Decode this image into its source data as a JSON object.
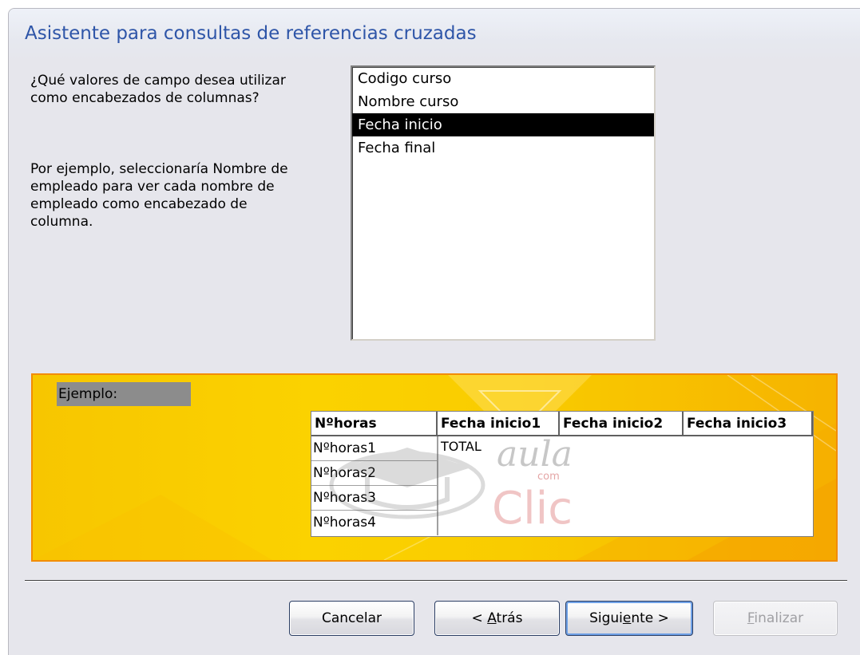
{
  "dialog": {
    "title": "Asistente para consultas de referencias cruzadas"
  },
  "prompts": {
    "question": "¿Qué valores de campo desea utilizar\ncomo encabezados de columnas?",
    "example": "Por ejemplo, seleccionaría Nombre de\nempleado para ver cada nombre de\nempleado como encabezado de\ncolumna."
  },
  "field_list": {
    "options": [
      "Codigo curso",
      "Nombre curso",
      "Fecha inicio",
      "Fecha final"
    ],
    "selected": "Fecha inicio"
  },
  "example": {
    "label": "Ejemplo:",
    "table": {
      "headers": [
        "Nºhoras",
        "Fecha inicio1",
        "Fecha inicio2",
        "Fecha inicio3"
      ],
      "rows": [
        "Nºhoras1",
        "Nºhoras2",
        "Nºhoras3",
        "Nºhoras4"
      ],
      "total": "TOTAL"
    },
    "watermark": {
      "line1": "aula",
      "line2": "com",
      "line3": "Clic"
    }
  },
  "buttons": {
    "cancel": {
      "label": "Cancelar",
      "enabled": true
    },
    "back": {
      "prefix": "< ",
      "mnemonic": "A",
      "rest": "trás",
      "enabled": true
    },
    "next": {
      "prefix": "Sigui",
      "mnemonic": "e",
      "rest": "nte >",
      "enabled": true,
      "default": true
    },
    "finish": {
      "mnemonic": "F",
      "rest": "inalizar",
      "enabled": false
    }
  },
  "colors": {
    "title": "#2e55a8",
    "panel_fill": "#fbd200",
    "panel_border": "#f28c00",
    "selection": "#000000"
  }
}
